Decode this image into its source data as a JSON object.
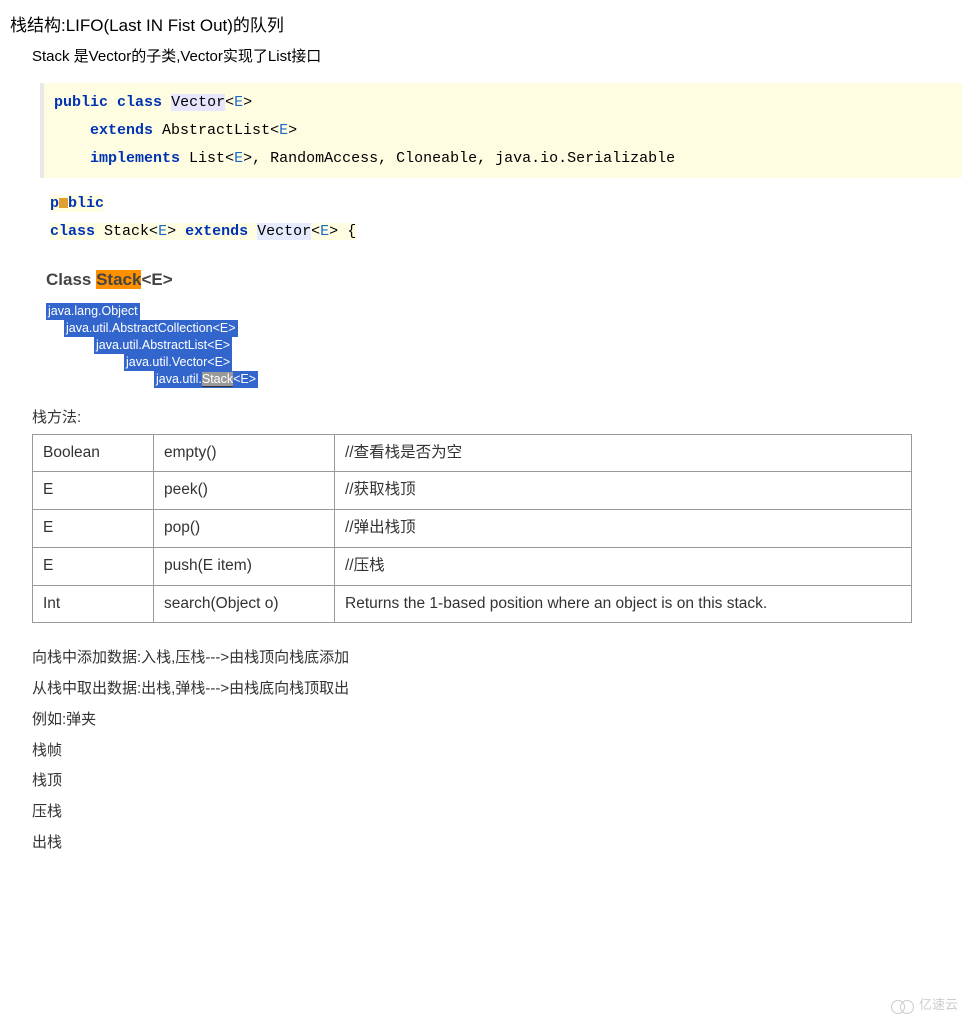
{
  "title": "栈结构:LIFO(Last IN Fist Out)的队列",
  "subtitle": "Stack 是Vector的子类,Vector实现了List接口",
  "code1": {
    "kw_public": "public",
    "kw_class": "class",
    "type_vector": "Vector",
    "gen_e": "E",
    "kw_extends": "extends",
    "type_abslist": "AbstractList",
    "kw_implements": "implements",
    "type_list": "List",
    "rest": ", RandomAccess, Cloneable, java.io.Serializable"
  },
  "code2": {
    "kw_public": "public",
    "kw_class": "class",
    "type_stack": "Stack",
    "gen_e": "E",
    "kw_extends": "extends",
    "type_vector": "Vector",
    "brace": " {"
  },
  "classTitle": {
    "prefix": "Class ",
    "stack": "Stack",
    "suffix": "<E>"
  },
  "hierarchy": {
    "h1": "java.lang.Object",
    "h2": "java.util.AbstractCollection<E>",
    "h3": "java.util.AbstractList<E>",
    "h4": "java.util.Vector<E>",
    "h5_prefix": "java.util.",
    "h5_stack": "Stack",
    "h5_suffix": "<E>"
  },
  "methodsLabel": "栈方法:",
  "table": {
    "rows": [
      {
        "ret": "Boolean",
        "method": "empty()",
        "desc": "//查看栈是否为空"
      },
      {
        "ret": "E",
        "method": "peek()",
        "desc": "//获取栈顶"
      },
      {
        "ret": "E",
        "method": "pop()",
        "desc": "//弹出栈顶"
      },
      {
        "ret": "E",
        "method": "push(E item)",
        "desc": "//压栈"
      },
      {
        "ret": "Int",
        "method": "search(Object o)",
        "desc": "Returns the 1-based position where an object is on this stack."
      }
    ]
  },
  "notes": [
    "向栈中添加数据:入栈,压栈--->由栈顶向栈底添加",
    "从栈中取出数据:出栈,弹栈--->由栈底向栈顶取出",
    "例如:弹夹",
    "栈帧",
    "栈顶",
    "压栈",
    "出栈"
  ],
  "watermark": "亿速云"
}
